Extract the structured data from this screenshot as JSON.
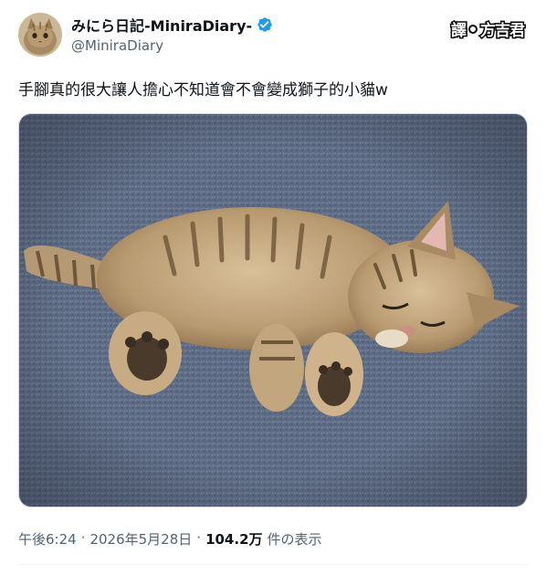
{
  "author": {
    "display_name": "みにら日記-MiniraDiary-",
    "handle": "@MiniraDiary",
    "verified_icon": "verified-badge-icon",
    "avatar_icon": "cat-avatar"
  },
  "watermark": {
    "left": "譯",
    "right": "方吉君"
  },
  "tweet": {
    "text": "手腳真的很大讓人擔心不知道會不會變成獅子的小貓w",
    "media_description": "kitten-photo"
  },
  "meta": {
    "time": "午後6:24",
    "dot": "·",
    "date": "2026年5月28日",
    "views_count": "104.2万",
    "views_label": "件の表示"
  },
  "colors": {
    "accent": "#1d9bf0",
    "text_secondary": "#536471",
    "text_primary": "#0f1419"
  }
}
